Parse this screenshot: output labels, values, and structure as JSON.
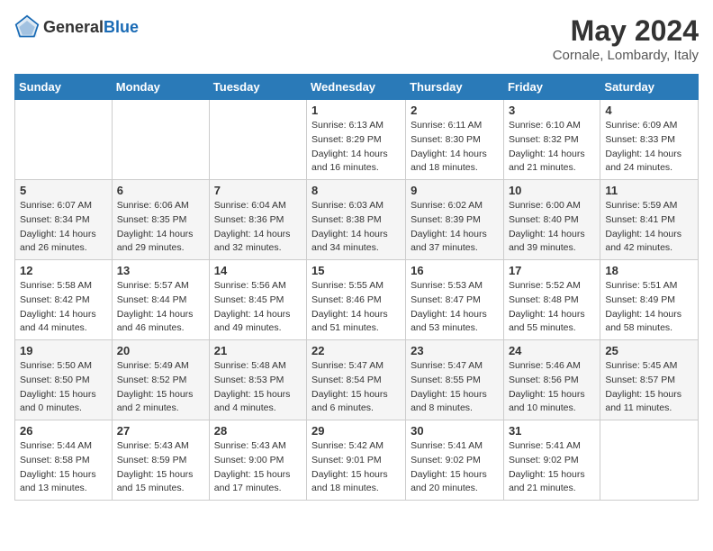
{
  "header": {
    "logo_general": "General",
    "logo_blue": "Blue",
    "month_title": "May 2024",
    "location": "Cornale, Lombardy, Italy"
  },
  "calendar": {
    "days_of_week": [
      "Sunday",
      "Monday",
      "Tuesday",
      "Wednesday",
      "Thursday",
      "Friday",
      "Saturday"
    ],
    "weeks": [
      {
        "cells": [
          {
            "day": "",
            "info": ""
          },
          {
            "day": "",
            "info": ""
          },
          {
            "day": "",
            "info": ""
          },
          {
            "day": "1",
            "info": "Sunrise: 6:13 AM\nSunset: 8:29 PM\nDaylight: 14 hours\nand 16 minutes."
          },
          {
            "day": "2",
            "info": "Sunrise: 6:11 AM\nSunset: 8:30 PM\nDaylight: 14 hours\nand 18 minutes."
          },
          {
            "day": "3",
            "info": "Sunrise: 6:10 AM\nSunset: 8:32 PM\nDaylight: 14 hours\nand 21 minutes."
          },
          {
            "day": "4",
            "info": "Sunrise: 6:09 AM\nSunset: 8:33 PM\nDaylight: 14 hours\nand 24 minutes."
          }
        ]
      },
      {
        "cells": [
          {
            "day": "5",
            "info": "Sunrise: 6:07 AM\nSunset: 8:34 PM\nDaylight: 14 hours\nand 26 minutes."
          },
          {
            "day": "6",
            "info": "Sunrise: 6:06 AM\nSunset: 8:35 PM\nDaylight: 14 hours\nand 29 minutes."
          },
          {
            "day": "7",
            "info": "Sunrise: 6:04 AM\nSunset: 8:36 PM\nDaylight: 14 hours\nand 32 minutes."
          },
          {
            "day": "8",
            "info": "Sunrise: 6:03 AM\nSunset: 8:38 PM\nDaylight: 14 hours\nand 34 minutes."
          },
          {
            "day": "9",
            "info": "Sunrise: 6:02 AM\nSunset: 8:39 PM\nDaylight: 14 hours\nand 37 minutes."
          },
          {
            "day": "10",
            "info": "Sunrise: 6:00 AM\nSunset: 8:40 PM\nDaylight: 14 hours\nand 39 minutes."
          },
          {
            "day": "11",
            "info": "Sunrise: 5:59 AM\nSunset: 8:41 PM\nDaylight: 14 hours\nand 42 minutes."
          }
        ]
      },
      {
        "cells": [
          {
            "day": "12",
            "info": "Sunrise: 5:58 AM\nSunset: 8:42 PM\nDaylight: 14 hours\nand 44 minutes."
          },
          {
            "day": "13",
            "info": "Sunrise: 5:57 AM\nSunset: 8:44 PM\nDaylight: 14 hours\nand 46 minutes."
          },
          {
            "day": "14",
            "info": "Sunrise: 5:56 AM\nSunset: 8:45 PM\nDaylight: 14 hours\nand 49 minutes."
          },
          {
            "day": "15",
            "info": "Sunrise: 5:55 AM\nSunset: 8:46 PM\nDaylight: 14 hours\nand 51 minutes."
          },
          {
            "day": "16",
            "info": "Sunrise: 5:53 AM\nSunset: 8:47 PM\nDaylight: 14 hours\nand 53 minutes."
          },
          {
            "day": "17",
            "info": "Sunrise: 5:52 AM\nSunset: 8:48 PM\nDaylight: 14 hours\nand 55 minutes."
          },
          {
            "day": "18",
            "info": "Sunrise: 5:51 AM\nSunset: 8:49 PM\nDaylight: 14 hours\nand 58 minutes."
          }
        ]
      },
      {
        "cells": [
          {
            "day": "19",
            "info": "Sunrise: 5:50 AM\nSunset: 8:50 PM\nDaylight: 15 hours\nand 0 minutes."
          },
          {
            "day": "20",
            "info": "Sunrise: 5:49 AM\nSunset: 8:52 PM\nDaylight: 15 hours\nand 2 minutes."
          },
          {
            "day": "21",
            "info": "Sunrise: 5:48 AM\nSunset: 8:53 PM\nDaylight: 15 hours\nand 4 minutes."
          },
          {
            "day": "22",
            "info": "Sunrise: 5:47 AM\nSunset: 8:54 PM\nDaylight: 15 hours\nand 6 minutes."
          },
          {
            "day": "23",
            "info": "Sunrise: 5:47 AM\nSunset: 8:55 PM\nDaylight: 15 hours\nand 8 minutes."
          },
          {
            "day": "24",
            "info": "Sunrise: 5:46 AM\nSunset: 8:56 PM\nDaylight: 15 hours\nand 10 minutes."
          },
          {
            "day": "25",
            "info": "Sunrise: 5:45 AM\nSunset: 8:57 PM\nDaylight: 15 hours\nand 11 minutes."
          }
        ]
      },
      {
        "cells": [
          {
            "day": "26",
            "info": "Sunrise: 5:44 AM\nSunset: 8:58 PM\nDaylight: 15 hours\nand 13 minutes."
          },
          {
            "day": "27",
            "info": "Sunrise: 5:43 AM\nSunset: 8:59 PM\nDaylight: 15 hours\nand 15 minutes."
          },
          {
            "day": "28",
            "info": "Sunrise: 5:43 AM\nSunset: 9:00 PM\nDaylight: 15 hours\nand 17 minutes."
          },
          {
            "day": "29",
            "info": "Sunrise: 5:42 AM\nSunset: 9:01 PM\nDaylight: 15 hours\nand 18 minutes."
          },
          {
            "day": "30",
            "info": "Sunrise: 5:41 AM\nSunset: 9:02 PM\nDaylight: 15 hours\nand 20 minutes."
          },
          {
            "day": "31",
            "info": "Sunrise: 5:41 AM\nSunset: 9:02 PM\nDaylight: 15 hours\nand 21 minutes."
          },
          {
            "day": "",
            "info": ""
          }
        ]
      }
    ]
  }
}
